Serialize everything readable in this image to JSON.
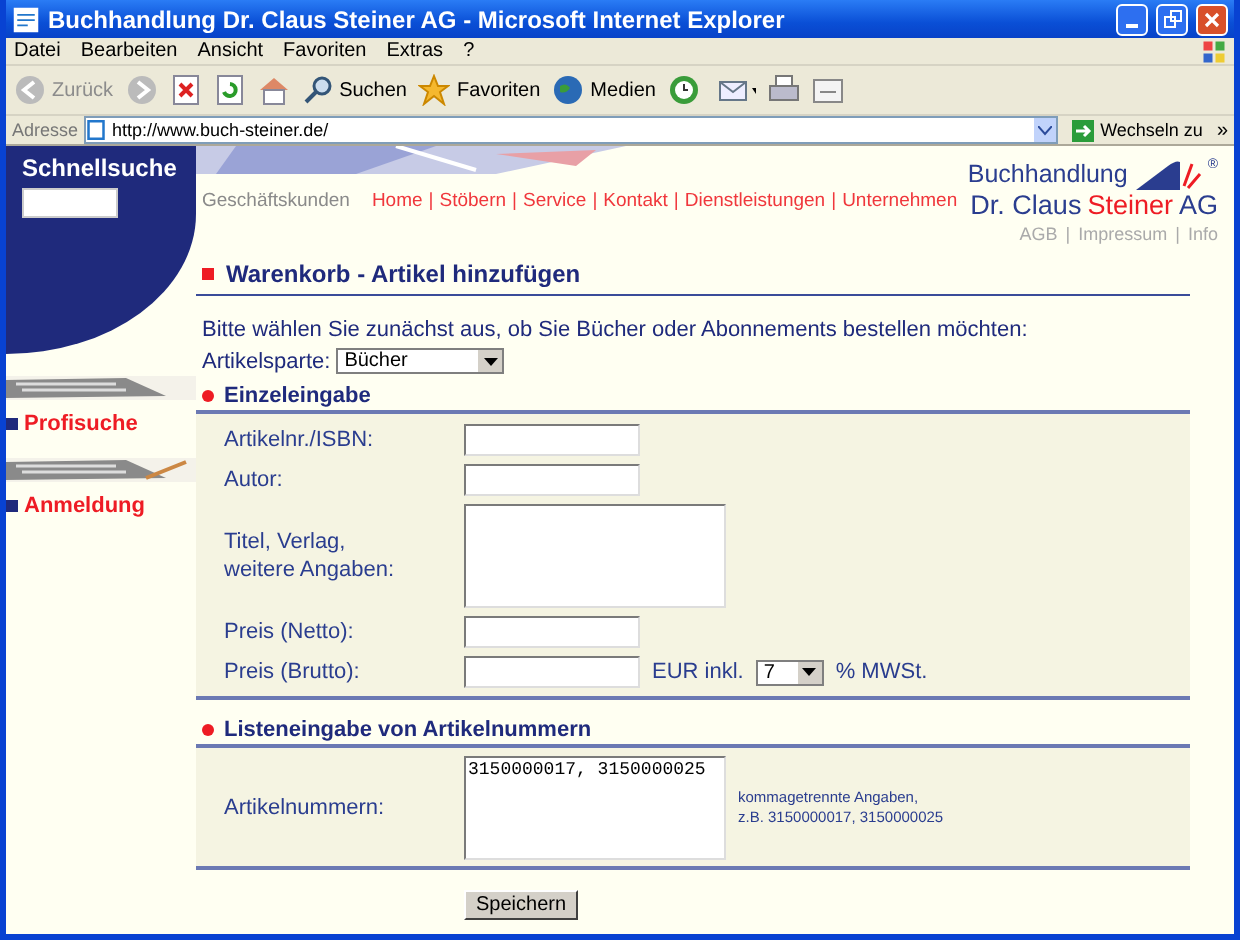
{
  "window": {
    "title": "Buchhandlung Dr. Claus Steiner AG - Microsoft Internet Explorer"
  },
  "menu": [
    "Datei",
    "Bearbeiten",
    "Ansicht",
    "Favoriten",
    "Extras",
    "?"
  ],
  "toolbar": [
    {
      "kind": "back",
      "label": "Zurück",
      "disabled": true
    },
    {
      "kind": "forward",
      "disabled": true
    },
    {
      "kind": "stop"
    },
    {
      "kind": "refresh"
    },
    {
      "kind": "home"
    },
    {
      "kind": "search",
      "label": "Suchen"
    },
    {
      "kind": "favorites",
      "label": "Favoriten"
    },
    {
      "kind": "media",
      "label": "Medien"
    },
    {
      "kind": "history"
    },
    {
      "kind": "mail"
    },
    {
      "kind": "print"
    },
    {
      "kind": "edit"
    }
  ],
  "address_bar": {
    "label": "Adresse",
    "url": "http://www.buch-steiner.de/",
    "go": "Wechseln zu",
    "more": "»"
  },
  "sidebar": {
    "search_title": "Schnellsuche",
    "links": [
      "Profisuche",
      "Anmeldung"
    ]
  },
  "nav": {
    "separator": "|",
    "items": [
      {
        "label": "Geschäftskunden",
        "kind": "plain"
      },
      {
        "label": "Home",
        "kind": "link"
      },
      {
        "label": "Stöbern",
        "kind": "link"
      },
      {
        "label": "Service",
        "kind": "link"
      },
      {
        "label": "Kontakt",
        "kind": "link"
      },
      {
        "label": "Dienstleistungen",
        "kind": "link"
      },
      {
        "label": "Unternehmen",
        "kind": "link"
      }
    ]
  },
  "logo": {
    "line1": "Buchhandlung",
    "line2": [
      {
        "text": "Dr. Claus",
        "accent": false
      },
      {
        "text": "Steiner",
        "accent": true
      },
      {
        "text": "AG",
        "accent": false
      }
    ],
    "registered": "®"
  },
  "footer": {
    "separator": "|",
    "links": [
      "AGB",
      "Impressum",
      "Info"
    ]
  },
  "heading": "Warenkorb - Artikel hinzufügen",
  "intro": "Bitte wählen Sie zunächst aus, ob Sie Bücher oder Abonnements bestellen möchten:",
  "category": {
    "label": "Artikelsparte:",
    "value": "Bücher"
  },
  "single_entry": {
    "title": "Einzeleingabe",
    "fields": [
      {
        "kind": "text",
        "label": "Artikelnr./ISBN:"
      },
      {
        "kind": "text",
        "label": "Autor:"
      },
      {
        "kind": "textarea",
        "label": "Titel, Verlag,\nweitere Angaben:"
      },
      {
        "kind": "text",
        "label": "Preis (Netto):"
      },
      {
        "kind": "vat",
        "label": "Preis (Brutto):",
        "currency": "EUR inkl.",
        "vat": "7",
        "suffix": "% MWSt."
      }
    ]
  },
  "list_entry": {
    "title": "Listeneingabe von Artikelnummern",
    "label": "Artikelnummern:",
    "value": "3150000017, 3150000025",
    "hint": "kommagetrennte Angaben,\nz.B. 3150000017, 3150000025"
  },
  "submit": "Speichern"
}
